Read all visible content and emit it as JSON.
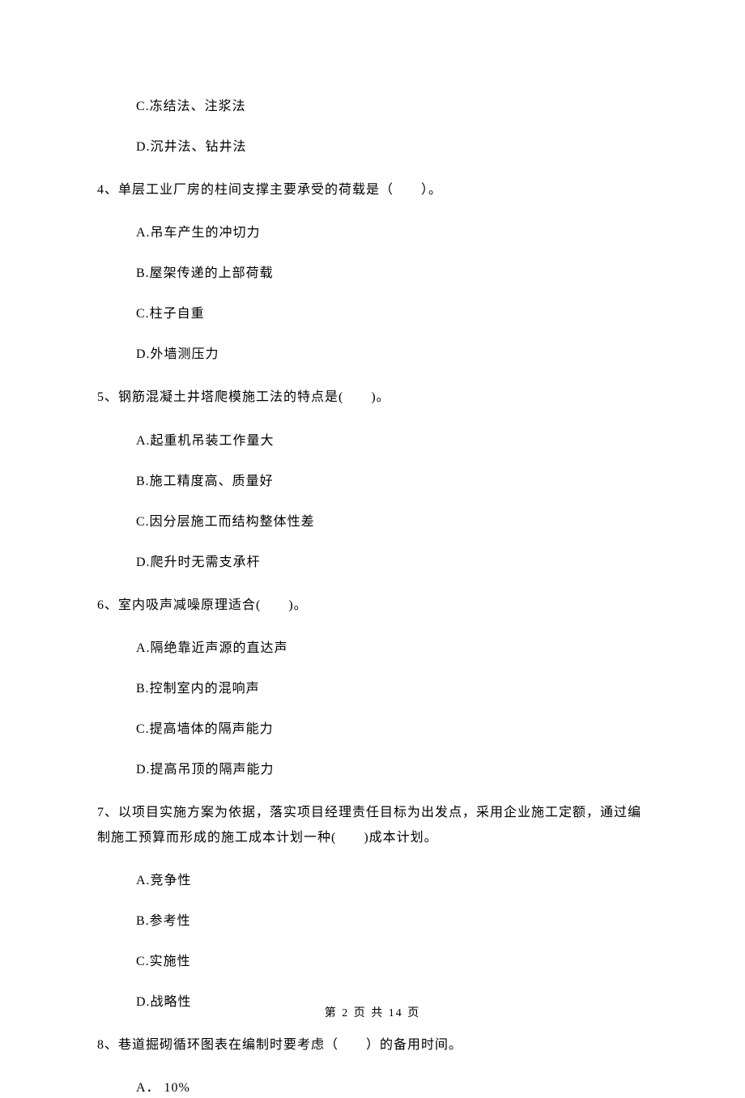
{
  "q3": {
    "options": {
      "c": "C.冻结法、注浆法",
      "d": "D.沉井法、钻井法"
    }
  },
  "q4": {
    "text": "4、单层工业厂房的柱间支撑主要承受的荷载是（　　）。",
    "options": {
      "a": "A.吊车产生的冲切力",
      "b": "B.屋架传递的上部荷载",
      "c": "C.柱子自重",
      "d": "D.外墙测压力"
    }
  },
  "q5": {
    "text": "5、钢筋混凝土井塔爬模施工法的特点是(　　)。",
    "options": {
      "a": "A.起重机吊装工作量大",
      "b": "B.施工精度高、质量好",
      "c": "C.因分层施工而结构整体性差",
      "d": "D.爬升时无需支承杆"
    }
  },
  "q6": {
    "text": "6、室内吸声减噪原理适合(　　)。",
    "options": {
      "a": "A.隔绝靠近声源的直达声",
      "b": "B.控制室内的混响声",
      "c": "C.提高墙体的隔声能力",
      "d": "D.提高吊顶的隔声能力"
    }
  },
  "q7": {
    "text": "7、以项目实施方案为依据，落实项目经理责任目标为出发点，采用企业施工定额，通过编制施工预算而形成的施工成本计划一种(　　)成本计划。",
    "options": {
      "a": "A.竞争性",
      "b": "B.参考性",
      "c": "C.实施性",
      "d": "D.战略性"
    }
  },
  "q8": {
    "text": "8、巷道掘砌循环图表在编制时要考虑（　　）的备用时间。",
    "options": {
      "a": "A． 10%"
    }
  },
  "footer": "第 2 页 共 14 页"
}
